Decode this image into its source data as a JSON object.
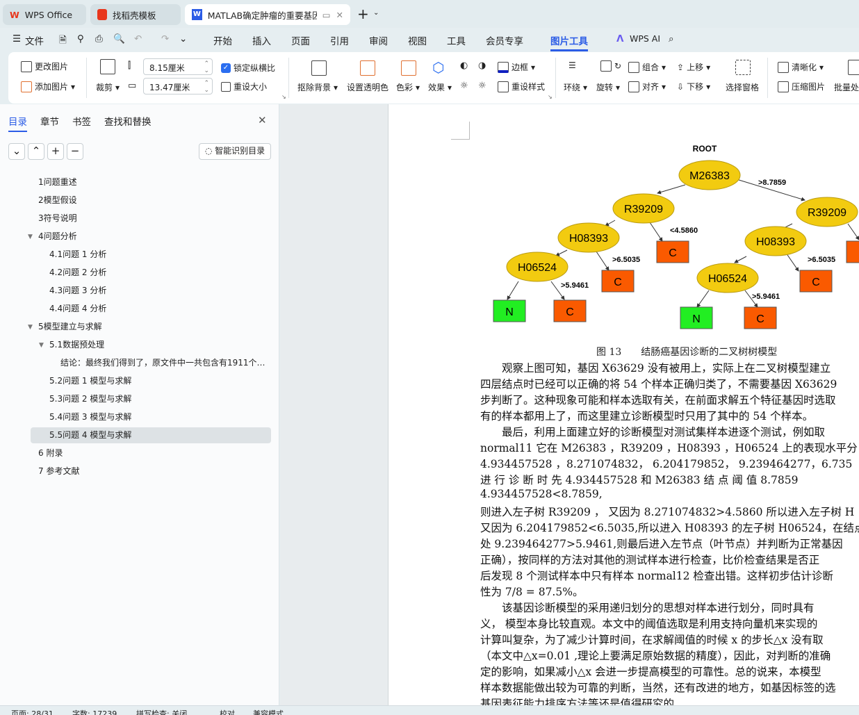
{
  "tabs": [
    {
      "label": "WPS Office",
      "icon": "wps-logo-icon"
    },
    {
      "label": "找稻壳模板",
      "icon": "docer-icon"
    },
    {
      "label": "MATLAB确定肿瘤的重要基因信",
      "icon": "word-doc-icon"
    }
  ],
  "menu": {
    "file": "文件",
    "items": [
      "开始",
      "插入",
      "页面",
      "引用",
      "审阅",
      "视图",
      "工具",
      "会员专享",
      "图片工具"
    ],
    "active": "图片工具",
    "ai": "WPS AI"
  },
  "ribbon": {
    "change_picture": "更改图片",
    "add_picture": "添加图片",
    "crop": "裁剪",
    "width": "8.15厘米",
    "height": "13.47厘米",
    "lock_ratio": "锁定纵横比",
    "lock_ratio_checked": true,
    "reset_size": "重设大小",
    "remove_bg": "抠除背景",
    "set_transparent": "设置透明色",
    "color": "色彩",
    "effects": "效果",
    "border": "边框",
    "reset_style": "重设样式",
    "wrap": "环绕",
    "rotate": "旋转",
    "group": "组合",
    "align": "对齐",
    "move_up": "上移",
    "move_down": "下移",
    "selection_pane": "选择窗格",
    "sharpen": "清晰化",
    "compress": "压缩图片",
    "batch": "批量处"
  },
  "nav": {
    "tabs": [
      "目录",
      "章节",
      "书签",
      "查找和替换"
    ],
    "active": "目录",
    "smart_toc": "智能识别目录",
    "items": [
      {
        "label": "1问题重述",
        "level": 1
      },
      {
        "label": "2模型假设",
        "level": 1
      },
      {
        "label": "3符号说明",
        "level": 1
      },
      {
        "label": "4问题分析",
        "level": 1,
        "expanded": true
      },
      {
        "label": "4.1问题 1 分析",
        "level": 2
      },
      {
        "label": "4.2问题 2 分析",
        "level": 2
      },
      {
        "label": "4.3问题 3 分析",
        "level": 2
      },
      {
        "label": "4.4问题 4 分析",
        "level": 2
      },
      {
        "label": "5模型建立与求解",
        "level": 1,
        "expanded": true
      },
      {
        "label": "5.1数据预处理",
        "level": 2,
        "expanded": true
      },
      {
        "label": "结论：最终我们得到了，原文件中一共包含有1911个…",
        "level": 3
      },
      {
        "label": "5.2问题 1 模型与求解",
        "level": 2
      },
      {
        "label": "5.3问题 2 模型与求解",
        "level": 2
      },
      {
        "label": "5.4问题 3 模型与求解",
        "level": 2
      },
      {
        "label": "5.5问题 4 模型与求解",
        "level": 2,
        "selected": true
      },
      {
        "label": "6 附录",
        "level": 1
      },
      {
        "label": "7 参考文献",
        "level": 1
      }
    ]
  },
  "figure": {
    "root": "ROOT",
    "nodes": [
      "M26383",
      "R39209",
      "R39209",
      "H08393",
      "H08393",
      "H06524",
      "H06524"
    ],
    "leaves": [
      "C",
      "C",
      "N",
      "C",
      "C",
      "N",
      "C"
    ],
    "edges": [
      ">8.7859",
      "<4.5860",
      ">6.5035",
      ">6.5035",
      ">5.9461",
      ">5.9461"
    ],
    "caption": "图 13　　结肠癌基因诊断的二叉树树模型",
    "colors": {
      "node": "#f2cb10",
      "cancer": "#fa5a00",
      "normal": "#22ee22"
    }
  },
  "body": [
    "　　观察上图可知，基因 X63629 没有被用上，实际上在二叉树模型建立",
    "四层结点时已经可以正确的将 54 个样本正确归类了，不需要基因 X63629",
    "步判断了。这种现象可能和样本选取有关，在前面求解五个特征基因时选取",
    "有的样本都用上了，而这里建立诊断模型时只用了其中的 54 个样本。",
    "　　最后，利用上面建立好的诊断模型对测试集样本进逐个测试，例如取",
    "normal11 它在  M26383 ，R39209 ，H08393 ，H06524 上的表现水平分",
    "4.934457528 ，8.271074832， 6.204179852， 9.239464277，6.735",
    "进 行 诊 断 时 先   4.934457528  和 M26383  结 点 阈 值   8.7859",
    "4.934457528<8.7859,",
    "则进入左子树 R39209 ， 又因为 8.271074832>4.5860 所以进入左子树 H",
    "又因为 6.204179852<6.5035,所以进入 H08393 的左子树 H06524，在结点",
    "处 9.239464277>5.9461,则最后进入左节点（叶节点）并判断为正常基因",
    "正确），按同样的方法对其他的测试样本进行检查，比价检查结果是否正",
    "后发现 8 个测试样本中只有样本 normal12 检查出错。这样初步估计诊断",
    "性为 7/8 = 87.5%。",
    "　　该基因诊断模型的采用递归划分的思想对样本进行划分，同时具有",
    "义，  模型本身比较直观。本文中的阈值选取是利用支持向量机来实现的",
    "计算叫复杂，为了减少计算时间，在求解阈值的时候 x 的步长△x 没有取",
    "（本文中△x=0.01 ,理论上要满足原始数据的精度），因此，对判断的准确",
    "定的影响，如果减小△x 会进一步提高模型的可靠性。总的说来，本模型",
    "样本数据能做出较为可靠的判断，当然，还有改进的地方，如基因标签的选",
    "基因表征能力排序方法等还是值得研究的"
  ],
  "status": {
    "page": "页面: 28/31",
    "words": "字数: 17239",
    "spell": "拼写检查: 关闭",
    "proof": "校对",
    "compat": "兼容模式"
  }
}
